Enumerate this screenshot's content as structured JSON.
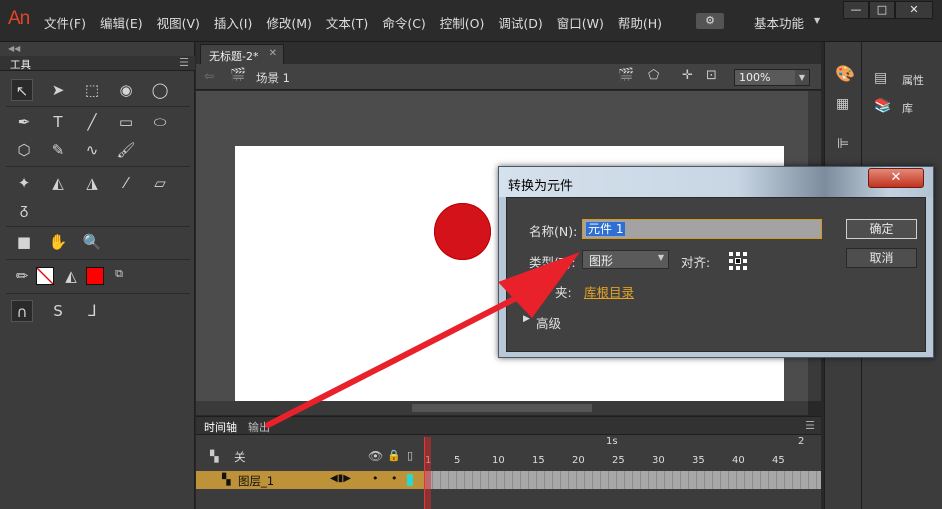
{
  "app": {
    "logo": "An",
    "workspace": "基本功能",
    "sync_icon": "gear-sync-icon",
    "window_controls": [
      "—",
      "□",
      "✕"
    ]
  },
  "menu": [
    "文件(F)",
    "编辑(E)",
    "视图(V)",
    "插入(I)",
    "修改(M)",
    "文本(T)",
    "命令(C)",
    "控制(O)",
    "调试(D)",
    "窗口(W)",
    "帮助(H)"
  ],
  "tools": {
    "title": "工具",
    "selected": "selection-tool"
  },
  "document": {
    "tab_title": "无标题-2*",
    "scene": "场景 1",
    "zoom": "100%",
    "circle_color": "#d4121a",
    "fill_color": "#ff0000"
  },
  "timeline": {
    "tabs": [
      "时间轴",
      "输出"
    ],
    "header_label": "关",
    "layer_name": "图层_1",
    "marker_1s": "1s",
    "marker_2s": "2",
    "frame_numbers": [
      "1",
      "5",
      "10",
      "15",
      "20",
      "25",
      "30",
      "35",
      "40",
      "45"
    ]
  },
  "right_panel": {
    "properties_label": "属性",
    "library_label": "库"
  },
  "dialog": {
    "title": "转换为元件",
    "name_label": "名称(N):",
    "name_value": "元件 1",
    "type_label": "类型(T):",
    "type_value": "图形",
    "align_label": "对齐:",
    "folder_label": "文件夹:",
    "folder_label_visible": "夹:",
    "folder_value": "库根目录",
    "advanced_label": "高级",
    "ok_label": "确定",
    "cancel_label": "取消",
    "close_label": "✕"
  },
  "annotation": {
    "arrow_color": "#e8212b"
  }
}
